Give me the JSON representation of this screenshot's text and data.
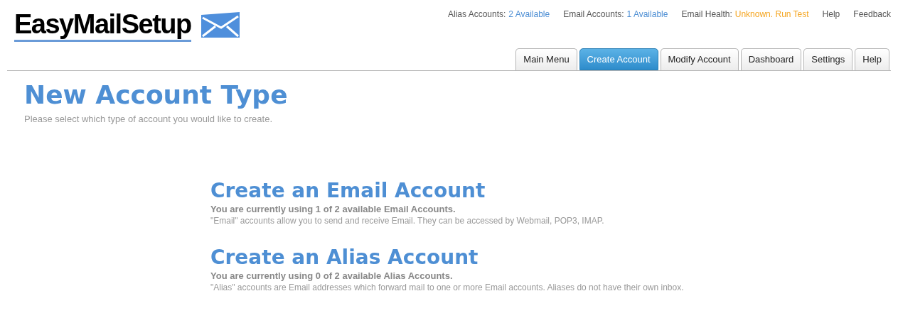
{
  "logo": {
    "text": "EasyMailSetup"
  },
  "status_bar": [
    {
      "kind": "count",
      "label": "Alias Accounts:",
      "value": "2 Available"
    },
    {
      "kind": "count",
      "label": "Email Accounts:",
      "value": "1 Available"
    },
    {
      "kind": "warning",
      "label": "Email Health:",
      "value": "Unknown. Run Test"
    },
    {
      "kind": "link",
      "label": "Help"
    },
    {
      "kind": "link",
      "label": "Feedback"
    }
  ],
  "tabs": [
    {
      "label": "Main Menu",
      "selected": false
    },
    {
      "label": "Create Account",
      "selected": true
    },
    {
      "label": "Modify Account",
      "selected": false
    },
    {
      "label": "Dashboard",
      "selected": false
    },
    {
      "label": "Settings",
      "selected": false
    },
    {
      "label": "Help",
      "selected": false
    }
  ],
  "page": {
    "title": "New Account Type",
    "subtitle": "Please select which type of account you would like to create."
  },
  "options": [
    {
      "title": "Create an Email Account",
      "usage": "You are currently using 1 of 2 available Email Accounts.",
      "description": "\"Email\" accounts allow you to send and receive Email. They can be accessed by Webmail, POP3, IMAP."
    },
    {
      "title": "Create an Alias Account",
      "usage": "You are currently using 0 of 2 available Alias Accounts.",
      "description": "\"Alias\" accounts are Email addresses which forward mail to one or more Email accounts. Aliases do not have their own inbox."
    }
  ]
}
